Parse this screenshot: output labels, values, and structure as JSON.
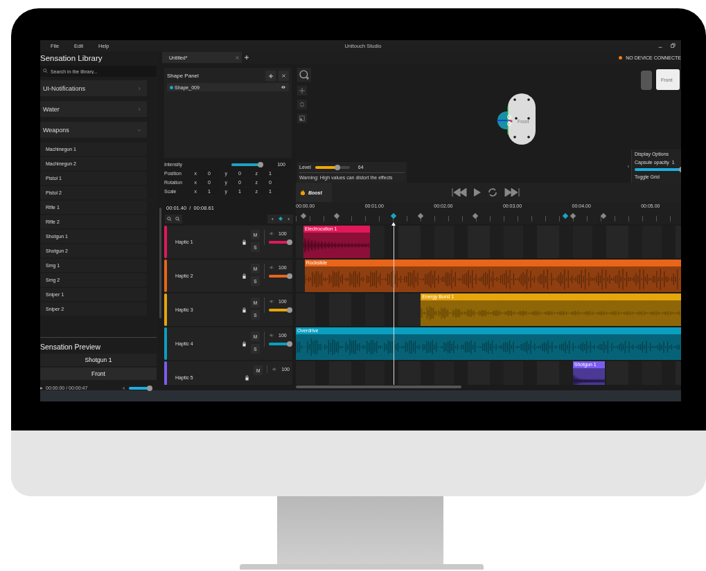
{
  "window": {
    "menu": [
      "File",
      "Edit",
      "Help"
    ],
    "title": "Unitouch Studio"
  },
  "library": {
    "title": "Sensation Library",
    "search": {
      "placeholder": "Search in the library..."
    },
    "categories": [
      {
        "label": "UI-Notifications",
        "expanded": false
      },
      {
        "label": "Water",
        "expanded": false
      },
      {
        "label": "Weapons",
        "expanded": true,
        "children": [
          "Machinegun 1",
          "Machinegun 2",
          "Pistol 1",
          "Pistol 2",
          "Rifle 1",
          "Rifle 2",
          "Shotgun 1",
          "Shotgun 2",
          "Smg 1",
          "Smg 2",
          "Sniper 1",
          "Sniper 2"
        ]
      }
    ]
  },
  "preview": {
    "title": "Sensation Preview",
    "sensation": "Shotgun 1",
    "view": "Front",
    "time": "00:00:00  / 00:00:47",
    "volume": {
      "level": 1
    }
  },
  "tabs": [
    {
      "label": "Untitled*",
      "selected": true
    }
  ],
  "shape_panel": {
    "title": "Shape Panel",
    "shapes": [
      {
        "name": "Shape_009",
        "visible": true
      }
    ],
    "intensity": {
      "label": "Intensity",
      "level": 1,
      "value": "100"
    },
    "transforms": [
      {
        "label": "Position",
        "values": [
          {
            "axis": "x",
            "value": "0"
          },
          {
            "axis": "y",
            "value": "0"
          },
          {
            "axis": "z",
            "value": "1"
          }
        ]
      },
      {
        "label": "Rotation",
        "values": [
          {
            "axis": "x",
            "value": "0"
          },
          {
            "axis": "y",
            "value": "0"
          },
          {
            "axis": "z",
            "value": "0"
          }
        ]
      },
      {
        "label": "Scale",
        "values": [
          {
            "axis": "x",
            "value": "1"
          },
          {
            "axis": "y",
            "value": "1"
          },
          {
            "axis": "z",
            "value": "1"
          }
        ]
      }
    ]
  },
  "status": {
    "device": "NO DEVICE CONNECTE"
  },
  "viewport": {
    "capsule_label": "Front",
    "cube_label": "Front",
    "level": {
      "label": "Level",
      "level": 0.64,
      "value": "64",
      "warning": "Warning: High values can distort the effects"
    },
    "display_options": {
      "title": "Display Options",
      "opacity_label": "Capsule opacity",
      "opacity_value": "1",
      "opacity": {
        "level": 1
      },
      "grid_label": "Toggle Grid"
    }
  },
  "transport": {
    "boost": "Boost"
  },
  "timeline": {
    "time": "00:01.40  /  00:08.61",
    "ruler": [
      "00:00.00",
      "00:01.00",
      "00:02.00",
      "00:03.00",
      "00:04.00",
      "00:05.00"
    ],
    "keyframes": [
      {
        "selected": false
      },
      {
        "selected": false
      },
      {
        "selected": true
      },
      {
        "selected": false
      },
      {
        "selected": false
      },
      {
        "selected": true
      },
      {
        "selected": false
      },
      {
        "selected": false
      }
    ]
  },
  "tracks": [
    {
      "name": "Haptic 1",
      "color": "#e0185a",
      "mute": "M",
      "solo": "S",
      "volume": "100",
      "level": 1,
      "clip": "Electrocution 1"
    },
    {
      "name": "Haptic 2",
      "color": "#e8651a",
      "mute": "M",
      "solo": "S",
      "volume": "100",
      "level": 1,
      "clip": "Rockslide"
    },
    {
      "name": "Haptic 3",
      "color": "#e6a50c",
      "mute": "M",
      "solo": "S",
      "volume": "100",
      "level": 1,
      "clip": "Energy Burst 1"
    },
    {
      "name": "Haptic 4",
      "color": "#0a9fc0",
      "mute": "M",
      "solo": "S",
      "volume": "100",
      "level": 1,
      "clip": "Overdrive"
    },
    {
      "name": "Haptic 5",
      "color": "#7b5cf0",
      "mute": "M",
      "volume": "100",
      "clip": "Shotgun 1"
    }
  ]
}
